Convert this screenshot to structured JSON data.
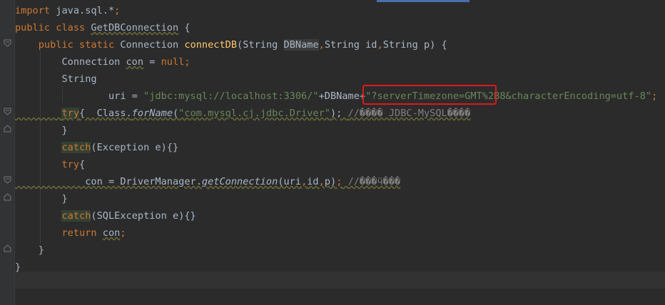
{
  "editor": {
    "lines": [
      {
        "parts": [
          {
            "t": "import",
            "c": "kw"
          },
          {
            "t": " java.sql.*",
            "c": ""
          },
          {
            "t": ";",
            "c": "kw"
          }
        ]
      },
      {
        "parts": [
          {
            "t": "public class",
            "c": "kw"
          },
          {
            "t": " ",
            "c": ""
          },
          {
            "t": "GetDBConnection",
            "c": "wavy"
          },
          {
            "t": " {",
            "c": ""
          }
        ]
      },
      {
        "parts": [
          {
            "t": "    ",
            "c": ""
          },
          {
            "t": "public static",
            "c": "kw"
          },
          {
            "t": " Connection ",
            "c": ""
          },
          {
            "t": "connectDB",
            "c": "fn"
          },
          {
            "t": "(String ",
            "c": ""
          },
          {
            "t": "DBName",
            "c": "hlvar"
          },
          {
            "t": ",",
            "c": "kw"
          },
          {
            "t": "String id",
            "c": ""
          },
          {
            "t": ",",
            "c": "kw"
          },
          {
            "t": "String p) {",
            "c": ""
          }
        ]
      },
      {
        "parts": [
          {
            "t": "        Connection ",
            "c": ""
          },
          {
            "t": "con",
            "c": "wavy"
          },
          {
            "t": " = ",
            "c": ""
          },
          {
            "t": "null",
            "c": "kw"
          },
          {
            "t": ";",
            "c": "kw"
          }
        ]
      },
      {
        "parts": [
          {
            "t": "        String",
            "c": ""
          }
        ]
      },
      {
        "parts": [
          {
            "t": "                uri = ",
            "c": ""
          },
          {
            "t": "\"jdbc:mysql://localhost:3306/\"",
            "c": "str"
          },
          {
            "t": "+DBName+",
            "c": ""
          },
          {
            "t": "\"?serverTimezone=GMT%2B8&characterEncoding=utf-8\"",
            "c": "str"
          },
          {
            "t": ";",
            "c": "kw"
          }
        ]
      },
      {
        "parts": [
          {
            "t": "        ",
            "c": ""
          },
          {
            "t": "try",
            "c": "kw hl"
          },
          {
            "t": "{  Class.",
            "c": ""
          },
          {
            "t": "forName",
            "c": "it"
          },
          {
            "t": "(",
            "c": ""
          },
          {
            "t": "\"com.mysql.cj.jdbc.Driver\"",
            "c": "str"
          },
          {
            "t": "); ",
            "c": ""
          },
          {
            "t": "//���� JDBC-MySQL����",
            "c": "cm"
          }
        ]
      },
      {
        "parts": [
          {
            "t": "        }",
            "c": ""
          }
        ]
      },
      {
        "parts": [
          {
            "t": "        ",
            "c": ""
          },
          {
            "t": "catch",
            "c": "kw hl"
          },
          {
            "t": "(Exception e){}",
            "c": ""
          }
        ]
      },
      {
        "parts": [
          {
            "t": "        ",
            "c": ""
          },
          {
            "t": "try",
            "c": "kw"
          },
          {
            "t": "{",
            "c": ""
          }
        ]
      },
      {
        "parts": [
          {
            "t": "            con = DriverManager.",
            "c": ""
          },
          {
            "t": "getConnection",
            "c": "it"
          },
          {
            "t": "(uri",
            "c": ""
          },
          {
            "t": ",",
            "c": "kw"
          },
          {
            "t": "id",
            "c": ""
          },
          {
            "t": ",",
            "c": "kw"
          },
          {
            "t": "p)",
            "c": ""
          },
          {
            "t": ";",
            "c": "kw"
          },
          {
            "t": " ",
            "c": ""
          },
          {
            "t": "//���ӵ���",
            "c": "cm"
          }
        ]
      },
      {
        "parts": [
          {
            "t": "        }",
            "c": ""
          }
        ]
      },
      {
        "parts": [
          {
            "t": "        ",
            "c": ""
          },
          {
            "t": "catch",
            "c": "kw hl"
          },
          {
            "t": "(SQLException e){}",
            "c": ""
          }
        ]
      },
      {
        "parts": [
          {
            "t": "        ",
            "c": ""
          },
          {
            "t": "return",
            "c": "kw"
          },
          {
            "t": " ",
            "c": ""
          },
          {
            "t": "con",
            "c": "wavy"
          },
          {
            "t": ";",
            "c": "kw"
          }
        ]
      },
      {
        "parts": [
          {
            "t": "    }",
            "c": ""
          }
        ]
      },
      {
        "parts": [
          {
            "t": "}",
            "c": ""
          }
        ]
      },
      {
        "parts": [
          {
            "t": "",
            "c": ""
          }
        ]
      }
    ]
  },
  "highlight": {
    "label": "?serverTimezone=GMT%2B8",
    "color": "#e0181b"
  }
}
